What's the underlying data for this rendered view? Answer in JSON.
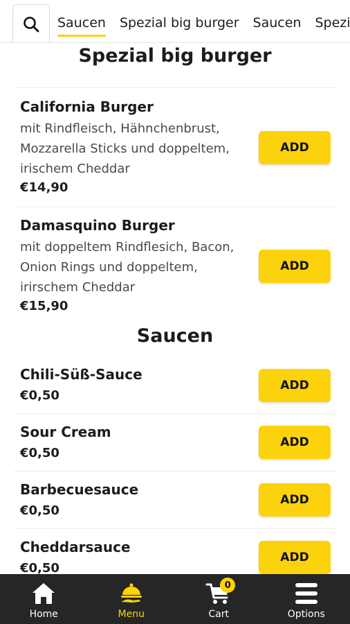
{
  "category_tabs": {
    "search_icon": "search-icon",
    "active_index": 0,
    "items": [
      "Saucen",
      "Spezial big burger",
      "Saucen",
      "Spezial big burger"
    ]
  },
  "sections": {
    "burger": {
      "title": "Spezial big burger",
      "items": [
        {
          "name": "California Burger",
          "description": "mit Rindfleisch, Hähnchenbrust, Mozzarella Sticks und doppeltem, irischem Cheddar",
          "price": "€14,90",
          "add_label": "ADD"
        },
        {
          "name": "Damasquino Burger",
          "description": "mit doppeltem Rindflesich, Bacon, Onion Rings und doppeltem, irirschem Cheddar",
          "price": "€15,90",
          "add_label": "ADD"
        }
      ]
    },
    "saucen": {
      "title": "Saucen",
      "items": [
        {
          "name": "Chili-Süß-Sauce",
          "price": "€0,50",
          "add_label": "ADD"
        },
        {
          "name": "Sour Cream",
          "price": "€0,50",
          "add_label": "ADD"
        },
        {
          "name": "Barbecuesauce",
          "price": "€0,50",
          "add_label": "ADD"
        },
        {
          "name": "Cheddarsauce",
          "price": "€0,50",
          "add_label": "ADD"
        }
      ]
    }
  },
  "bottom_nav": {
    "items": [
      {
        "label": "Home",
        "icon": "home-icon"
      },
      {
        "label": "Menu",
        "icon": "serving-cloche-icon"
      },
      {
        "label": "Cart",
        "icon": "cart-icon"
      },
      {
        "label": "Options",
        "icon": "menu-bars-icon"
      }
    ],
    "active_index": 1,
    "cart_count": "0"
  },
  "colors": {
    "accent": "#fcd20c",
    "nav_background": "#262626",
    "text": "#1c1c1c",
    "muted_text": "#4a4a4a"
  }
}
